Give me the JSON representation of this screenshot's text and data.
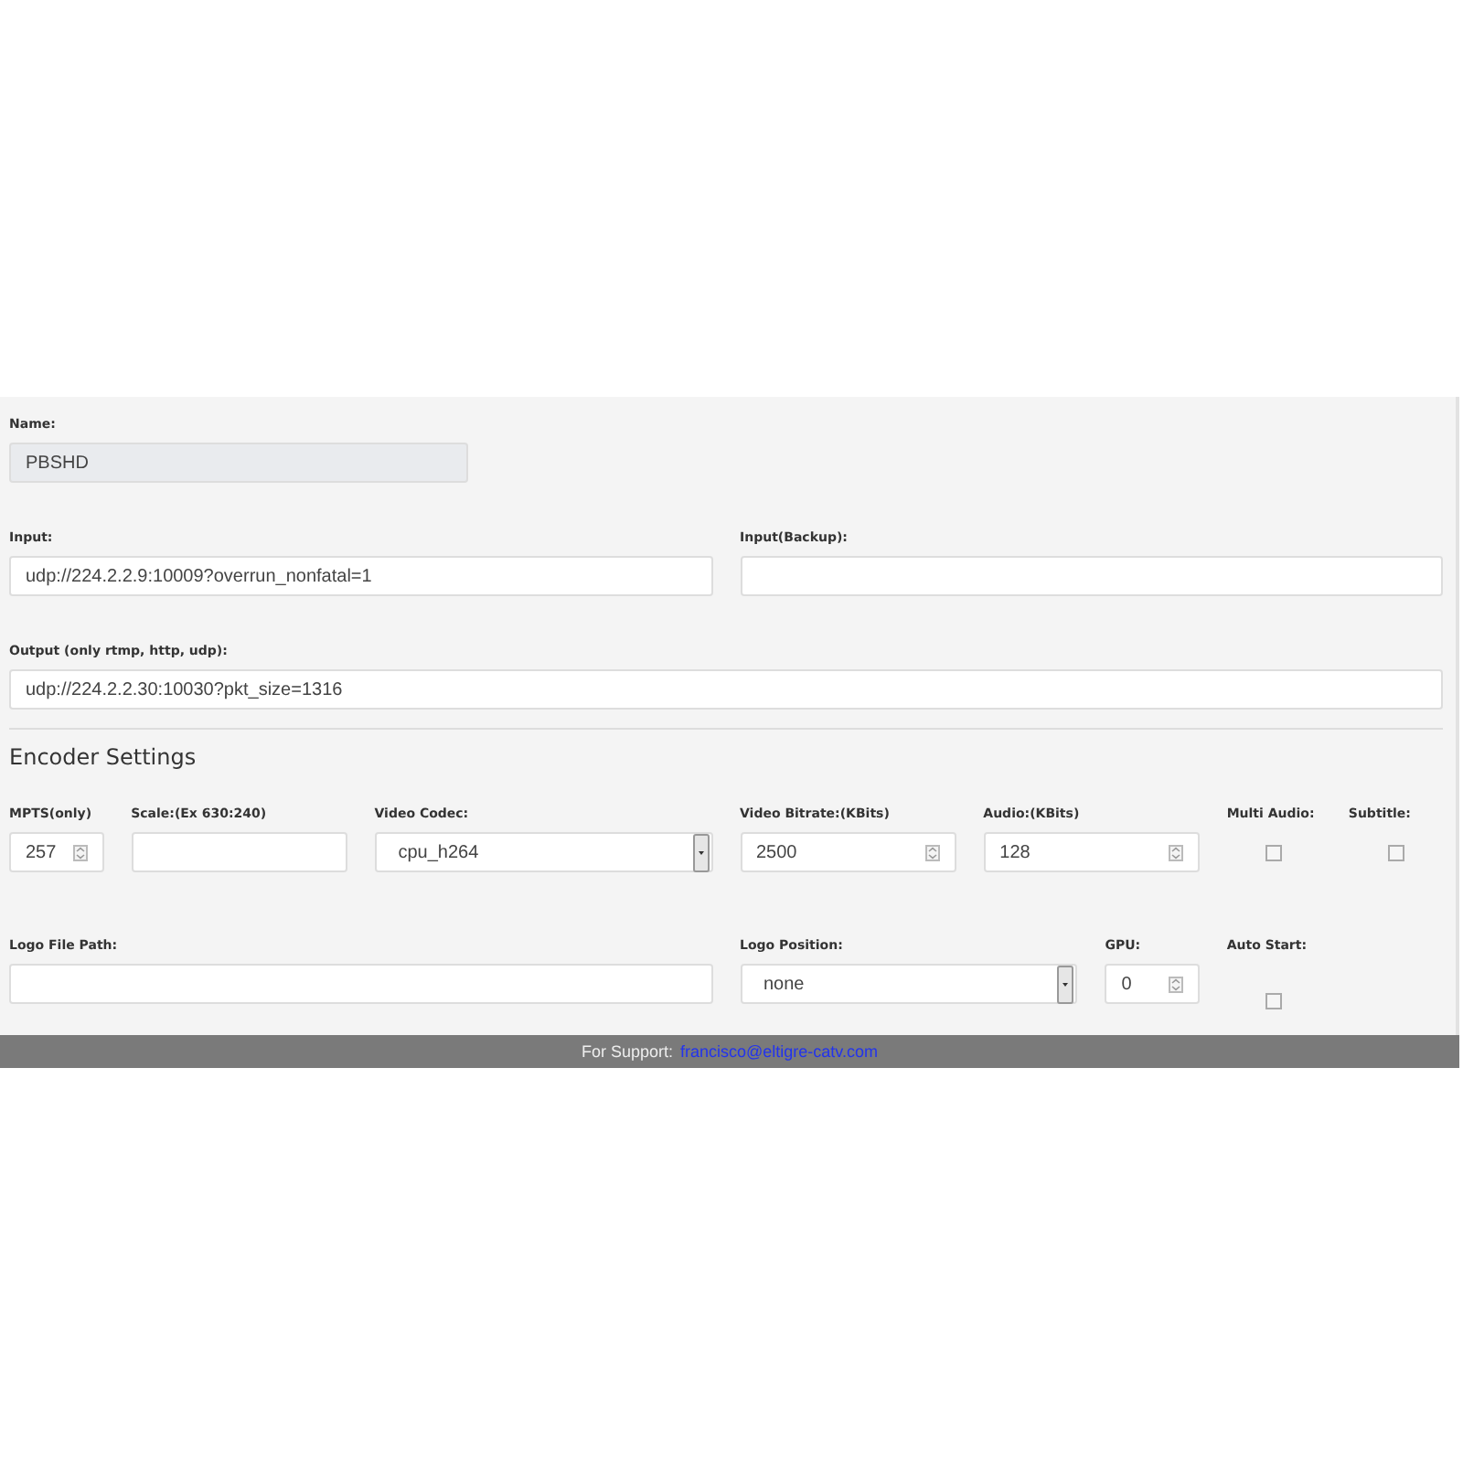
{
  "general": [
    [
      {
        "label": "Name:",
        "value": "PBSHD",
        "disabled": true
      }
    ],
    [
      {
        "label": "Input:",
        "value": "udp://224.2.2.9:10009?overrun_nonfatal=1",
        "disabled": false
      },
      {
        "label": "Input(Backup):",
        "disabled": false
      }
    ],
    [
      {
        "label": "Output (only rtmp, http, udp):",
        "value": "udp://224.2.2.30:10030?pkt_size=1316",
        "disabled": false
      }
    ]
  ],
  "encoder_settings": {
    "title": "Encoder Settings",
    "fields": [
      {
        "kind": "number",
        "label": "MPTS(only)",
        "value": "257"
      },
      {
        "kind": "text",
        "label": "Scale:(Ex 630:240)",
        "disabled": false
      },
      {
        "kind": "select",
        "label": "Video Codec:",
        "value": "cpu_h264"
      },
      {
        "kind": "number",
        "label": "Video Bitrate:(KBits)",
        "value": "2500"
      },
      {
        "kind": "number",
        "label": "Audio:(KBits)",
        "value": "128"
      },
      {
        "kind": "checkbox",
        "label": "Multi Audio:",
        "checked": false
      },
      {
        "kind": "checkbox",
        "label": "Subtitle:",
        "checked": false
      },
      {
        "kind": "text",
        "label": "Logo File Path:",
        "disabled": false
      },
      {
        "kind": "select",
        "label": "Logo Position:",
        "value": "none"
      },
      {
        "kind": "number",
        "label": "GPU:",
        "value": "0"
      },
      {
        "kind": "checkbox",
        "label": "Auto Start:",
        "checked": false
      }
    ]
  },
  "footer": {
    "text": "For Support:",
    "link": "francisco@eltigre-catv.com"
  }
}
